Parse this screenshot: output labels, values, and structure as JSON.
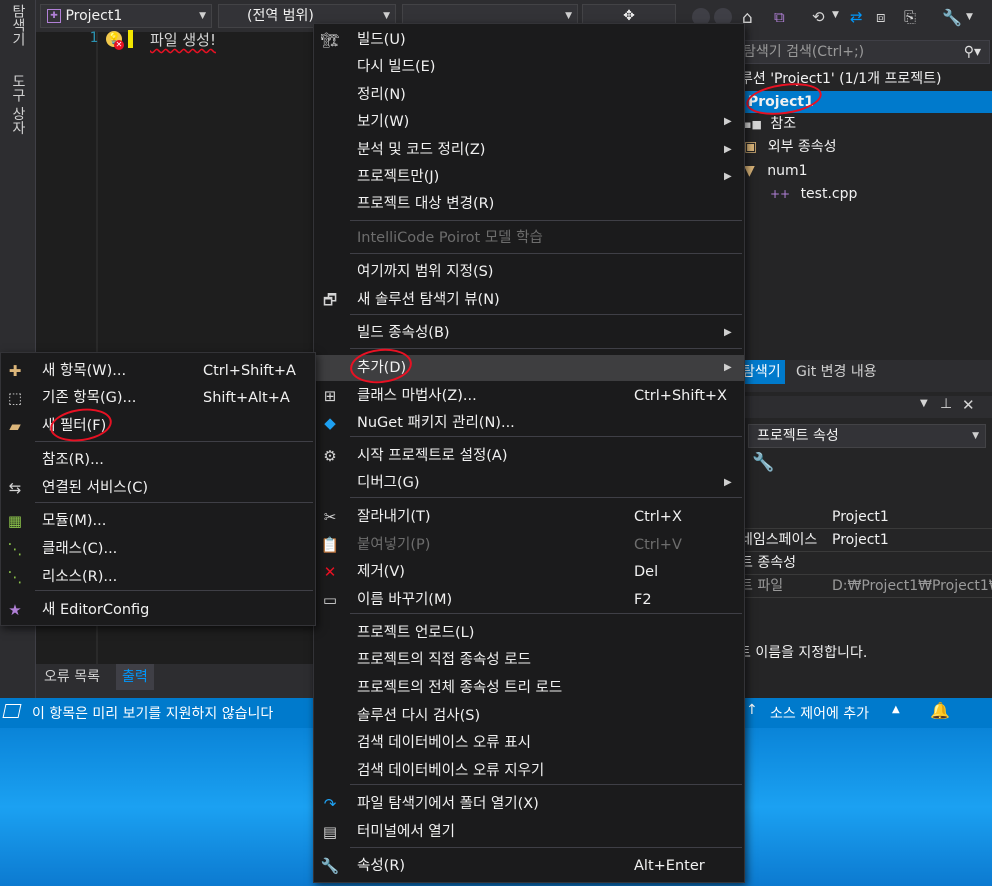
{
  "left_strip": {
    "tab1": "탐색기",
    "tab2": "도구 상자"
  },
  "toolbar": {
    "project_combo": "Project1",
    "scope_combo": "(전역 범위)"
  },
  "editor": {
    "line_number": "1",
    "code_text": "파일 생성!"
  },
  "bottom_tabs": {
    "error_list": "오류 목록",
    "output": "출력"
  },
  "statusbar": {
    "message": "이 항목은 미리 보기를 지원하지 않습니다",
    "source_control": "소스 제어에 추가"
  },
  "solution_explorer": {
    "search_placeholder": "탐색기 검색(Ctrl+;)",
    "solution_item": "루션 'Project1' (1/1개 프로젝트)",
    "project_item": "Project1",
    "references": "참조",
    "external_deps": "외부 종속성",
    "filter_num1": "num1",
    "file_test": "test.cpp"
  },
  "panel_tabs": {
    "explorer": "탐색기",
    "git_changes": "Git 변경 내용"
  },
  "properties": {
    "combo": "프로젝트 속성",
    "rows": [
      {
        "key": "",
        "value": "Project1"
      },
      {
        "key": "네임스페이스",
        "value": "Project1"
      },
      {
        "key": "트 종속성",
        "value": ""
      },
      {
        "key": "트 파일",
        "value": "D:₩Project1₩Project1₩"
      }
    ],
    "description": "트 이름을 지정합니다."
  },
  "main_menu": {
    "items": [
      {
        "label": "빌드(U)",
        "shortcut": "",
        "submenu": false,
        "disabled": false
      },
      {
        "label": "다시 빌드(E)",
        "shortcut": "",
        "submenu": false,
        "disabled": false
      },
      {
        "label": "정리(N)",
        "shortcut": "",
        "submenu": false,
        "disabled": false
      },
      {
        "label": "보기(W)",
        "shortcut": "",
        "submenu": true,
        "disabled": false
      },
      {
        "label": "분석 및 코드 정리(Z)",
        "shortcut": "",
        "submenu": true,
        "disabled": false
      },
      {
        "label": "프로젝트만(J)",
        "shortcut": "",
        "submenu": true,
        "disabled": false
      },
      {
        "label": "프로젝트 대상 변경(R)",
        "shortcut": "",
        "submenu": false,
        "disabled": false
      },
      {
        "label": "IntelliCode Poirot 모델 학습",
        "shortcut": "",
        "submenu": false,
        "disabled": true
      },
      {
        "label": "여기까지 범위 지정(S)",
        "shortcut": "",
        "submenu": false,
        "disabled": false
      },
      {
        "label": "새 솔루션 탐색기 뷰(N)",
        "shortcut": "",
        "submenu": false,
        "disabled": false
      },
      {
        "label": "빌드 종속성(B)",
        "shortcut": "",
        "submenu": true,
        "disabled": false
      },
      {
        "label": "추가(D)",
        "shortcut": "",
        "submenu": true,
        "disabled": false
      },
      {
        "label": "클래스 마법사(Z)...",
        "shortcut": "Ctrl+Shift+X",
        "submenu": false,
        "disabled": false
      },
      {
        "label": "NuGet 패키지 관리(N)...",
        "shortcut": "",
        "submenu": false,
        "disabled": false
      },
      {
        "label": "시작 프로젝트로 설정(A)",
        "shortcut": "",
        "submenu": false,
        "disabled": false
      },
      {
        "label": "디버그(G)",
        "shortcut": "",
        "submenu": true,
        "disabled": false
      },
      {
        "label": "잘라내기(T)",
        "shortcut": "Ctrl+X",
        "submenu": false,
        "disabled": false
      },
      {
        "label": "붙여넣기(P)",
        "shortcut": "Ctrl+V",
        "submenu": false,
        "disabled": true
      },
      {
        "label": "제거(V)",
        "shortcut": "Del",
        "submenu": false,
        "disabled": false
      },
      {
        "label": "이름 바꾸기(M)",
        "shortcut": "F2",
        "submenu": false,
        "disabled": false
      },
      {
        "label": "프로젝트 언로드(L)",
        "shortcut": "",
        "submenu": false,
        "disabled": false
      },
      {
        "label": "프로젝트의 직접 종속성 로드",
        "shortcut": "",
        "submenu": false,
        "disabled": false
      },
      {
        "label": "프로젝트의 전체 종속성 트리 로드",
        "shortcut": "",
        "submenu": false,
        "disabled": false
      },
      {
        "label": "솔루션 다시 검사(S)",
        "shortcut": "",
        "submenu": false,
        "disabled": false
      },
      {
        "label": "검색 데이터베이스 오류 표시",
        "shortcut": "",
        "submenu": false,
        "disabled": false
      },
      {
        "label": "검색 데이터베이스 오류 지우기",
        "shortcut": "",
        "submenu": false,
        "disabled": false
      },
      {
        "label": "파일 탐색기에서 폴더 열기(X)",
        "shortcut": "",
        "submenu": false,
        "disabled": false
      },
      {
        "label": "터미널에서 열기",
        "shortcut": "",
        "submenu": false,
        "disabled": false
      },
      {
        "label": "속성(R)",
        "shortcut": "Alt+Enter",
        "submenu": false,
        "disabled": false
      }
    ]
  },
  "add_submenu": {
    "items": [
      {
        "label": "새 항목(W)...",
        "shortcut": "Ctrl+Shift+A"
      },
      {
        "label": "기존 항목(G)...",
        "shortcut": "Shift+Alt+A"
      },
      {
        "label": "새 필터(F)",
        "shortcut": ""
      },
      {
        "label": "참조(R)...",
        "shortcut": ""
      },
      {
        "label": "연결된 서비스(C)",
        "shortcut": ""
      },
      {
        "label": "모듈(M)...",
        "shortcut": ""
      },
      {
        "label": "클래스(C)...",
        "shortcut": ""
      },
      {
        "label": "리소스(R)...",
        "shortcut": ""
      },
      {
        "label": "새 EditorConfig",
        "shortcut": ""
      }
    ]
  },
  "colors": {
    "accent": "#007acc",
    "menu_bg": "#1b1b1c",
    "annotation_red": "#e81123"
  }
}
